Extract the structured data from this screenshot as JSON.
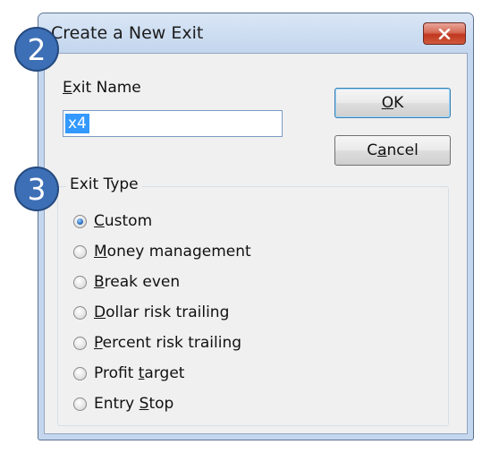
{
  "window": {
    "title": "Create a New Exit"
  },
  "form": {
    "exit_name_label": "Exit Name",
    "exit_name_value": "x4",
    "ok_label": "OK",
    "cancel_label": "Cancel"
  },
  "exit_type": {
    "legend": "Exit Type",
    "options": [
      {
        "label": "Custom",
        "checked": true
      },
      {
        "label": "Money management",
        "checked": false
      },
      {
        "label": "Break even",
        "checked": false
      },
      {
        "label": "Dollar risk trailing",
        "checked": false
      },
      {
        "label": "Percent risk trailing",
        "checked": false
      },
      {
        "label": "Profit target",
        "checked": false
      },
      {
        "label": "Entry Stop",
        "checked": false
      }
    ]
  },
  "badges": {
    "step_2": "2",
    "step_3": "3"
  },
  "colors": {
    "accent": "#3d6fb6",
    "close": "#c1371f",
    "selection": "#3399ff"
  }
}
